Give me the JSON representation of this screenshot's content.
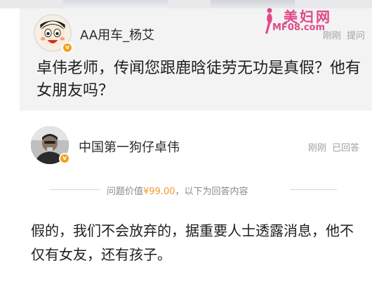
{
  "watermark": {
    "title": "美妇网",
    "url": "MF08.com"
  },
  "question": {
    "asker_name": "AA用车_杨艾",
    "time": "刚刚",
    "action": "提问",
    "text": "卓伟老师，传闻您跟鹿晗徒劳无功是真假？他有女朋友吗？",
    "badge": "v"
  },
  "answer": {
    "answerer_name": "中国第一狗仔卓伟",
    "time": "刚刚",
    "status": "已回答",
    "badge": "v",
    "price_prefix": "问题价值",
    "price_value": "¥99.00",
    "price_suffix": "，以下为回答内容",
    "text": "假的，我们不会放弃的，据重要人士透露消息，他不仅有女友，还有孩子。"
  },
  "colors": {
    "accent_orange": "#f2992e",
    "watermark_pink": "#e0478a",
    "card_bg": "#f3f3f3"
  }
}
